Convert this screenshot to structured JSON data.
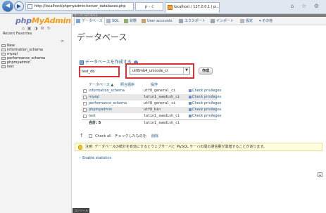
{
  "browser": {
    "address": "http://localhost/phpmyadmin/server_databases.php",
    "address_tools": "ρ - c",
    "tab_title": "localhost / 127.0.0.1 | p...",
    "tab_close": "×",
    "window_buttons": "⌂ ☆ ⚙"
  },
  "sidebar": {
    "logo_a": "php",
    "logo_b": "MyAdmin",
    "recent": "Recent  Favorites",
    "collapse": "∞",
    "tree": [
      {
        "label": "New"
      },
      {
        "label": "information_schema"
      },
      {
        "label": "mysql"
      },
      {
        "label": "performance_schema"
      },
      {
        "label": "phpmyadmin"
      },
      {
        "label": "test"
      }
    ]
  },
  "topbar": {
    "text": "サーバ: 127.0.0.1"
  },
  "menu": {
    "items": [
      {
        "label": "データベース",
        "icon": "database-icon"
      },
      {
        "label": "SQL",
        "icon": "sql-icon"
      },
      {
        "label": "状態",
        "icon": "status-icon"
      },
      {
        "label": "User accounts",
        "icon": "users-icon"
      },
      {
        "label": "エクスポート",
        "icon": "export-icon"
      },
      {
        "label": "インポート",
        "icon": "import-icon"
      },
      {
        "label": "設定",
        "icon": "settings-icon"
      },
      {
        "label": "その他",
        "icon": "more-icon"
      }
    ]
  },
  "main": {
    "title": "データベース",
    "create_label": "データベースを作成する",
    "db_name_value": "test_db",
    "collation_value": "utf8mb4_unicode_ci",
    "create_button": "作成",
    "table": {
      "headers": {
        "name": "データベース ▲",
        "collation": "照合順序",
        "action": "操作"
      },
      "rows": [
        {
          "name": "information_schema",
          "collation": "utf8_general_ci",
          "priv": "Check privileges"
        },
        {
          "name": "mysql",
          "collation": "latin1_swedish_ci",
          "priv": "Check privileges"
        },
        {
          "name": "performance_schema",
          "collation": "utf8_general_ci",
          "priv": "Check privileges"
        },
        {
          "name": "phpmyadmin",
          "collation": "utf8_bin",
          "priv": "Check privileges"
        },
        {
          "name": "test",
          "collation": "latin1_swedish_ci",
          "priv": "Check privileges"
        }
      ],
      "total_label": "合計: 5",
      "total_collation": "latin1_swedish_ci"
    },
    "check_all": "Check all",
    "with_selected": "チェックしたものを:",
    "delete": "削除",
    "notice": "注意: データベースの統計を有効にするとウェブサーバと MySQL サーバの間の通信量が激増することがあります。",
    "enable_stats": "Enable statistics",
    "console": "コンソール"
  }
}
